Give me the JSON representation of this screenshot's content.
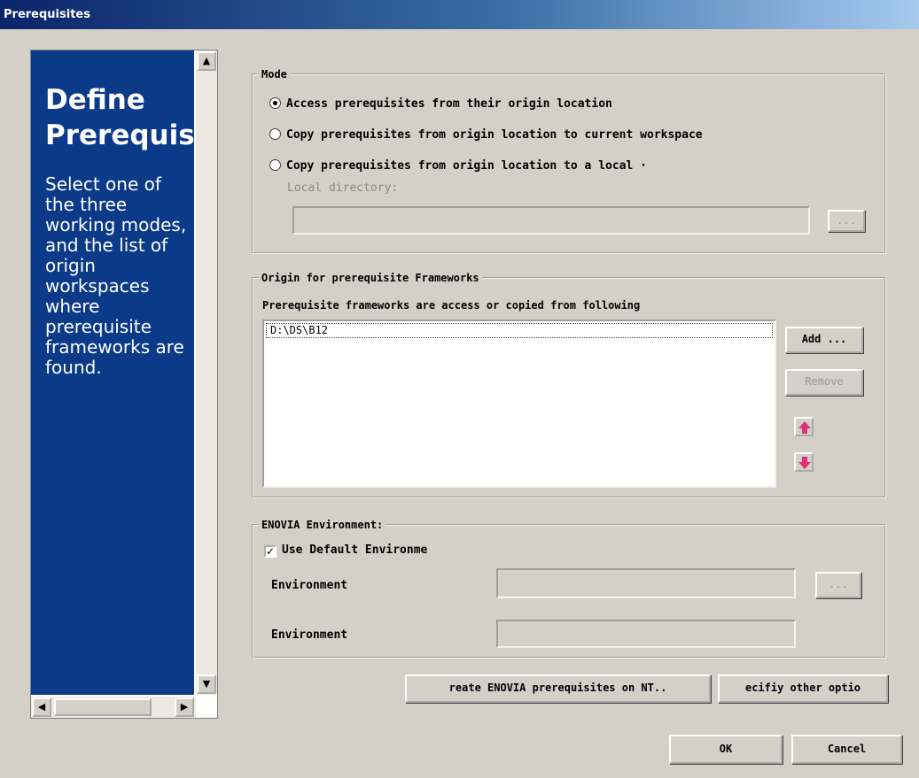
{
  "window": {
    "title": "Prerequisites"
  },
  "help": {
    "title_line1": "Define",
    "title_line2": "Prerequisites",
    "text": "Select one of the three working modes, and the list of origin workspaces where prerequisite frameworks are found."
  },
  "mode": {
    "legend": "Mode",
    "options": [
      {
        "label": "Access prerequisites from their origin location",
        "selected": true
      },
      {
        "label": "Copy prerequisites from origin location to current workspace",
        "selected": false
      },
      {
        "label": "Copy prerequisites from origin location to a local ·",
        "selected": false
      }
    ],
    "local_directory_label": "Local directory:",
    "local_directory_value": "",
    "browse_label": "..."
  },
  "origin": {
    "legend": "Origin for prerequisite Frameworks",
    "description": "Prerequisite frameworks are access or copied from following",
    "items": [
      "D:\\DS\\B12"
    ],
    "add_label": "Add ...",
    "remove_label": "Remove"
  },
  "enovia": {
    "legend": "ENOVIA Environment:",
    "use_default_label": "Use Default Environme",
    "use_default_checked": true,
    "env1_label": "Environment",
    "env1_value": "",
    "env2_label": "Environment",
    "env2_value": "",
    "browse_label": "..."
  },
  "actions": {
    "create_label": "reate ENOVIA prerequisites on NT..",
    "specify_label": "ecifiy other optio"
  },
  "footer": {
    "ok_label": "OK",
    "cancel_label": "Cancel"
  },
  "colors": {
    "help_bg": "#0a3a88",
    "title_gradient_start": "#0a246a",
    "arrow": "#e0307a"
  },
  "icons": {
    "move_up": "arrow-up-icon",
    "move_down": "arrow-down-icon"
  }
}
